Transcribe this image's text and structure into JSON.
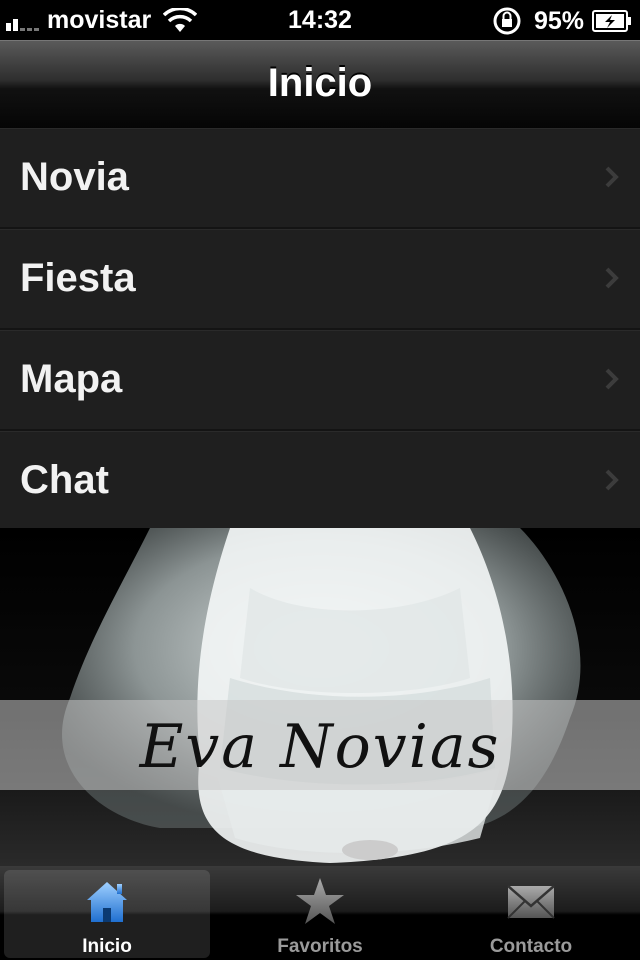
{
  "status_bar": {
    "carrier": "movistar",
    "time": "14:32",
    "battery": "95%"
  },
  "nav": {
    "title": "Inicio"
  },
  "menu": {
    "items": [
      {
        "label": "Novia"
      },
      {
        "label": "Fiesta"
      },
      {
        "label": "Mapa"
      },
      {
        "label": "Chat"
      }
    ]
  },
  "banner": {
    "logo": "Eva Novias"
  },
  "tabs": [
    {
      "label": "Inicio",
      "icon": "home-icon",
      "active": true
    },
    {
      "label": "Favoritos",
      "icon": "star-icon",
      "active": false
    },
    {
      "label": "Contacto",
      "icon": "mail-icon",
      "active": false
    }
  ],
  "colors": {
    "accent": "#3a8ee0",
    "background": "#1f1f1f"
  }
}
